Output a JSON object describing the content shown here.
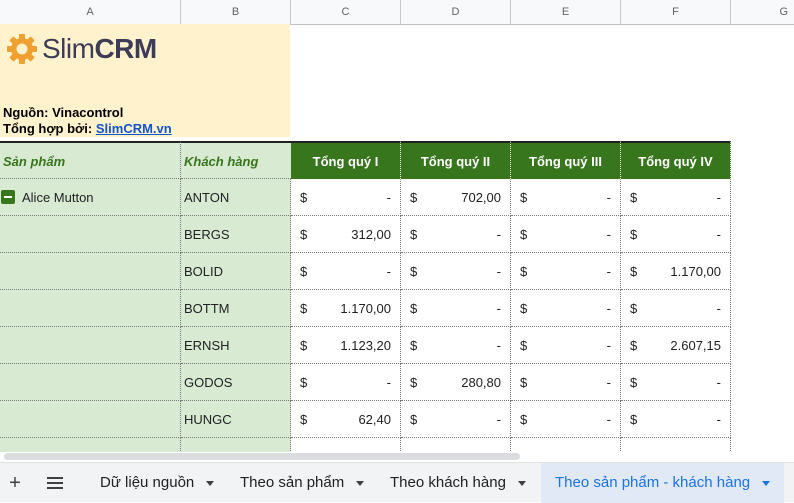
{
  "columns": [
    "A",
    "B",
    "C",
    "D",
    "E",
    "F",
    "G"
  ],
  "logo": {
    "slim": "Slim",
    "crm": "CRM",
    "accent": "#f0a030"
  },
  "source_line": "Nguồn: Vinacontrol",
  "compiled_prefix": "Tổng hợp bởi: ",
  "compiled_link": "SlimCRM.vn",
  "headers": {
    "product": "Sản phẩm",
    "customer": "Khách hàng",
    "quarters": [
      "Tổng quý I",
      "Tổng quý II",
      "Tổng quý III",
      "Tổng quý IV"
    ]
  },
  "product_group": "Alice Mutton",
  "currency": "$",
  "rows": [
    {
      "customer": "ANTON",
      "q": [
        "-",
        "702,00",
        "-",
        "-"
      ]
    },
    {
      "customer": "BERGS",
      "q": [
        "312,00",
        "-",
        "-",
        "-"
      ]
    },
    {
      "customer": "BOLID",
      "q": [
        "-",
        "-",
        "-",
        "1.170,00"
      ]
    },
    {
      "customer": "BOTTM",
      "q": [
        "1.170,00",
        "-",
        "-",
        "-"
      ]
    },
    {
      "customer": "ERNSH",
      "q": [
        "1.123,20",
        "-",
        "-",
        "2.607,15"
      ]
    },
    {
      "customer": "GODOS",
      "q": [
        "-",
        "280,80",
        "-",
        "-"
      ]
    },
    {
      "customer": "HUNGC",
      "q": [
        "62,40",
        "-",
        "-",
        "-"
      ]
    }
  ],
  "tabs": [
    "Dữ liệu nguồn",
    "Theo sản phẩm",
    "Theo khách hàng",
    "Theo sản phẩm - khách hàng"
  ],
  "active_tab_index": 3,
  "colors": {
    "header_dark": "#38761d",
    "header_light": "#d9ead3",
    "logo_bg": "#fff2cc",
    "active_tab": "#1a73e8"
  }
}
